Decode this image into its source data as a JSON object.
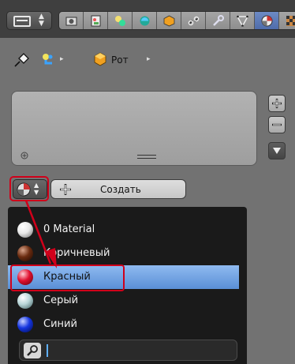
{
  "tabbar": {
    "editor_icon": "properties-editor-icon",
    "tabs": [
      {
        "icon": "render-icon",
        "active": false
      },
      {
        "icon": "scene-icon",
        "active": false
      },
      {
        "icon": "world-icon",
        "active": false
      },
      {
        "icon": "object-icon",
        "active": false
      },
      {
        "icon": "object-data-icon",
        "active": false
      },
      {
        "icon": "constraints-icon",
        "active": false
      },
      {
        "icon": "modifier-wrench-icon",
        "active": false
      },
      {
        "icon": "mesh-data-icon",
        "active": false
      },
      {
        "icon": "material-icon",
        "active": true
      },
      {
        "icon": "texture-icon",
        "active": false
      }
    ]
  },
  "breadcrumb": {
    "pin_icon": "pin-icon",
    "items": [
      {
        "icon": "object-icon",
        "label": ""
      },
      {
        "icon": "mesh-icon",
        "label": "Рот"
      }
    ],
    "separator": "▸"
  },
  "material_slots": {
    "side_buttons": [
      "add-slot-button",
      "remove-slot-button",
      "slot-menu-button"
    ]
  },
  "datablock": {
    "new_label": "Создать"
  },
  "menu": {
    "items": [
      {
        "label": "0 Material",
        "color": "#e8e8e8",
        "selected": false
      },
      {
        "label": "Коричневый",
        "color": "#6b2c10",
        "selected": false
      },
      {
        "label": "Красный",
        "color": "#e0102e",
        "selected": true
      },
      {
        "label": "Серый",
        "color": "#b9d6d8",
        "selected": false
      },
      {
        "label": "Синий",
        "color": "#1535e0",
        "selected": false
      }
    ],
    "search_value": ""
  },
  "colors": {
    "annotation": "#d0001a",
    "selection": "#5a8fd6"
  }
}
